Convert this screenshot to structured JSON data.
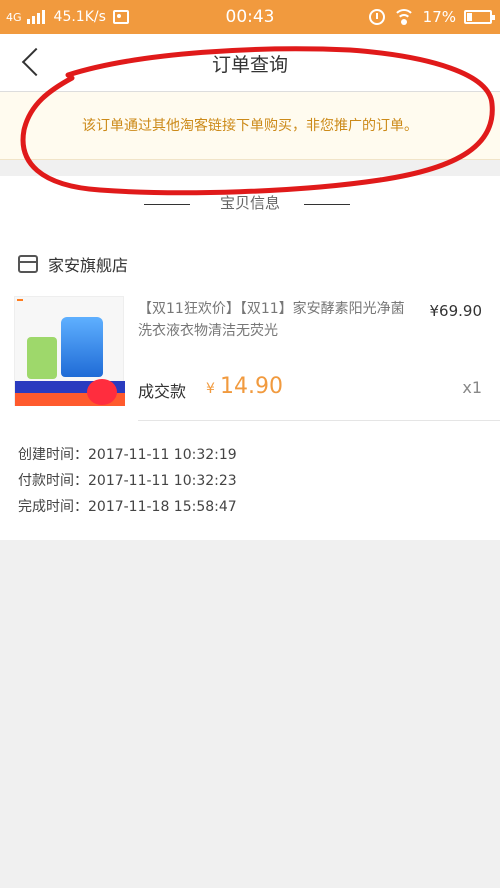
{
  "status_bar": {
    "network": "4G",
    "speed": "45.1K/s",
    "time": "00:43",
    "battery": "17%"
  },
  "header": {
    "title": "订单查询"
  },
  "notice": {
    "text": "该订单通过其他淘客链接下单购买，非您推广的订单。"
  },
  "section": {
    "title": "宝贝信息"
  },
  "store": {
    "name": "家安旗舰店"
  },
  "product": {
    "title": "【双11狂欢价】【双11】家安酵素阳光净菌洗衣液衣物清洁无荧光",
    "unit_price": "¥69.90",
    "deal_label": "成交款",
    "deal_currency": "¥",
    "deal_amount": "14.90",
    "quantity": "x1"
  },
  "order_times": {
    "created": "创建时间：2017-11-11 10:32:19",
    "paid": "付款时间：2017-11-11 10:32:23",
    "completed": "完成时间：2017-11-18 15:58:47"
  },
  "colors": {
    "status_bar": "#f19a3e",
    "accent": "#f19a3e",
    "notice_text": "#cc8a19",
    "annotation": "#e01a1a"
  }
}
